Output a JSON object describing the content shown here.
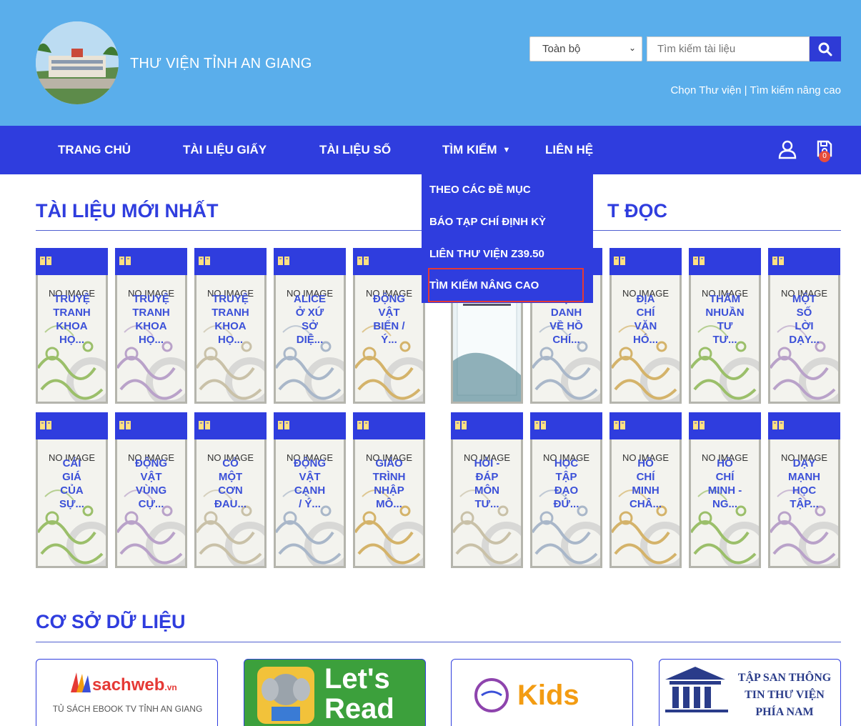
{
  "header": {
    "site_title": "THƯ VIỆN TỈNH AN GIANG",
    "search_scope": "Toàn bộ",
    "search_placeholder": "Tìm kiếm tài liệu",
    "link_choose_library": "Chọn Thư viện",
    "link_separator": "|",
    "link_advanced_search": "Tìm kiếm nâng cao"
  },
  "nav": {
    "items": [
      "TRANG CHỦ",
      "TÀI LIỆU GIẤY",
      "TÀI LIỆU SỐ",
      "TÌM KIẾM",
      "LIÊN HỆ"
    ],
    "cart_count": "0"
  },
  "dropdown": {
    "items": [
      "THEO CÁC ĐỀ MỤC",
      "BÁO TẠP CHÍ ĐỊNH KỲ",
      "LIÊN THƯ VIỆN Z39.50",
      "TÌM KIẾM NÂNG CAO"
    ]
  },
  "sections": {
    "newest_title": "TÀI LIỆU MỚI NHẤT",
    "popular_title_partial": "T ĐỌC",
    "databases_title": "CƠ SỞ DỮ LIỆU"
  },
  "newest_books": [
    {
      "no_image": "NO IMAGE",
      "lines": [
        "TRUYỆ",
        "TRANH",
        "KHOA",
        "HỌ..."
      ]
    },
    {
      "no_image": "NO IMAGE",
      "lines": [
        "TRUYỆ",
        "TRANH",
        "KHOA",
        "HỌ..."
      ]
    },
    {
      "no_image": "NO IMAGE",
      "lines": [
        "TRUYỆ",
        "TRANH",
        "KHOA",
        "HỌ..."
      ]
    },
    {
      "no_image": "NO IMAGE",
      "lines": [
        "ALICE",
        "Ở XỨ",
        "SỞ",
        "DIỆ..."
      ]
    },
    {
      "no_image": "NO IMAGE",
      "lines": [
        "ĐỘNG",
        "VẬT",
        "BIỂN /",
        "Ý..."
      ]
    },
    {
      "no_image": "NO IMAGE",
      "lines": [
        "CÁI",
        "GIÁ",
        "CỦA",
        "SỰ..."
      ]
    },
    {
      "no_image": "NO IMAGE",
      "lines": [
        "ĐỘNG",
        "VẬT",
        "VÙNG",
        "CỰ..."
      ]
    },
    {
      "no_image": "NO IMAGE",
      "lines": [
        "CÓ",
        "MỘT",
        "CƠN",
        "ĐAU..."
      ]
    },
    {
      "no_image": "NO IMAGE",
      "lines": [
        "ĐỘNG",
        "VẬT",
        "CẠNH",
        "/ Ý..."
      ]
    },
    {
      "no_image": "NO IMAGE",
      "lines": [
        "GIÁO",
        "TRÌNH",
        "NHẬP",
        "MÔ..."
      ]
    }
  ],
  "popular_books": [
    {
      "no_image": "",
      "lines": []
    },
    {
      "no_image": "",
      "lines": [
        "ĐỊA",
        "DANH",
        "VỀ HỒ",
        "CHÍ..."
      ]
    },
    {
      "no_image": "NO IMAGE",
      "lines": [
        "ĐỊA",
        "CHÍ",
        "VĂN",
        "HÓ..."
      ]
    },
    {
      "no_image": "NO IMAGE",
      "lines": [
        "THẤM",
        "NHUẦN",
        "TƯ",
        "TƯ..."
      ]
    },
    {
      "no_image": "NO IMAGE",
      "lines": [
        "MỘT",
        "SỐ",
        "LỜI",
        "DẠY..."
      ]
    },
    {
      "no_image": "NO IMAGE",
      "lines": [
        "HỎI -",
        "ĐÁP",
        "MÔN",
        "TƯ..."
      ]
    },
    {
      "no_image": "NO IMAGE",
      "lines": [
        "HỌC",
        "TẬP",
        "ĐẠO",
        "ĐỨ..."
      ]
    },
    {
      "no_image": "NO IMAGE",
      "lines": [
        "HỒ",
        "CHÍ",
        "MINH",
        "CHÂ..."
      ]
    },
    {
      "no_image": "NO IMAGE",
      "lines": [
        "HỒ",
        "CHÍ",
        "MINH -",
        "NG..."
      ]
    },
    {
      "no_image": "NO IMAGE",
      "lines": [
        "DẠY",
        "MẠNH",
        "HỌC",
        "TẬP..."
      ]
    }
  ],
  "databases": [
    {
      "logo_text": "sachweb",
      "logo_suffix": ".vn",
      "caption": "TỦ SÁCH EBOOK TV TỈNH AN GIANG"
    },
    {
      "logo_text": "Let's Read"
    },
    {
      "logo_text": "Kids"
    },
    {
      "logo_text": "TẬP SAN THÔNG TIN THƯ VIỆN PHÍA NAM"
    }
  ],
  "colors": {
    "header_bg": "#5aaeeb",
    "nav_bg": "#2f3dde",
    "accent": "#2f3dde",
    "highlight": "#e53935"
  }
}
